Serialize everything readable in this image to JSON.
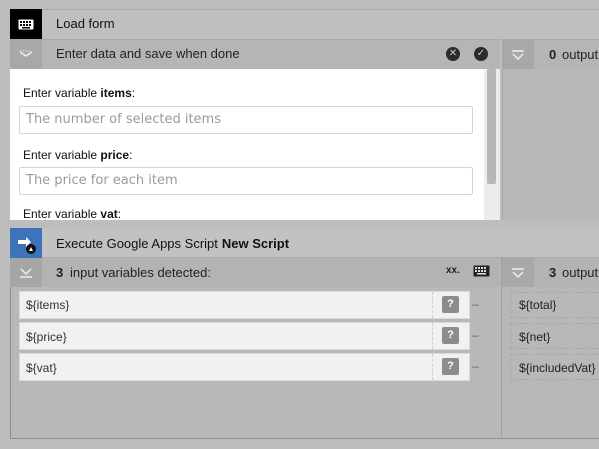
{
  "block1": {
    "title": "Load form",
    "subtitle": "Enter data and save when done",
    "output_count": "0",
    "output_label": "output"
  },
  "form": {
    "prefix": "Enter variable",
    "fields": [
      {
        "name": "items",
        "placeholder": "The number of selected items"
      },
      {
        "name": "price",
        "placeholder": "The price for each item"
      },
      {
        "name": "vat",
        "placeholder": ""
      }
    ]
  },
  "block2": {
    "title": "Execute Google Apps Script",
    "script_name": "New Script",
    "input_count": "3",
    "input_label": "input variables detected:",
    "xx_label": "xx.",
    "output_count": "3",
    "output_label": "output",
    "inputs": [
      "${items}",
      "${price}",
      "${vat}"
    ],
    "help_label": "?",
    "dash": "–",
    "outputs": [
      "${total}",
      "${net}",
      "${includedVat}"
    ]
  },
  "icons": {
    "block1": "keyboard-icon",
    "block2": "arrow-right-icon",
    "drive": "google-drive-icon"
  }
}
